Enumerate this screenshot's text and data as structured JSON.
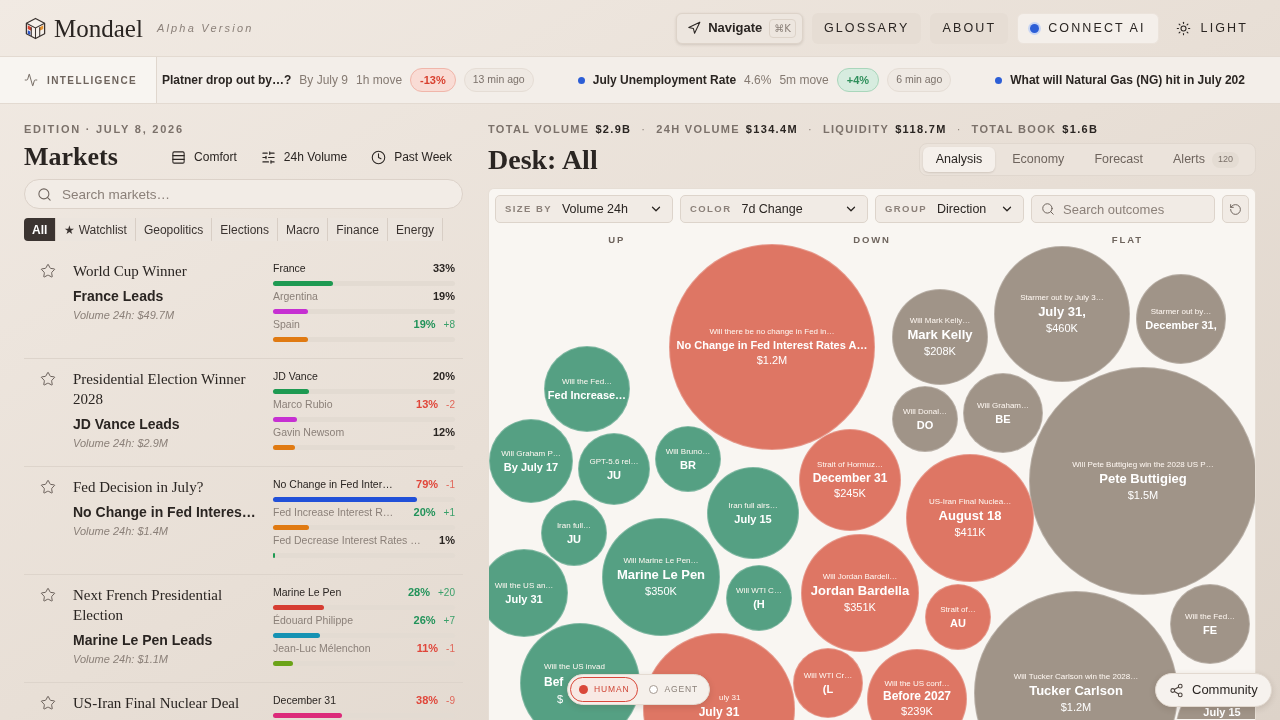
{
  "header": {
    "logo": "Mondael",
    "tagline": "Alpha Version",
    "navigate": {
      "label": "Navigate",
      "shortcut": "⌘K"
    },
    "links": [
      {
        "label": "GLOSSARY",
        "kind": "plain"
      },
      {
        "label": "ABOUT",
        "kind": "plain"
      },
      {
        "label": "CONNECT AI",
        "kind": "connect"
      }
    ],
    "theme_toggle": "LIGHT"
  },
  "ticker": {
    "label": "INTELLIGENCE",
    "items": [
      {
        "bullet": false,
        "title": "Platner drop out by…?",
        "detail": "By July 9",
        "window": "1h move",
        "change": "-13%",
        "kind": "down",
        "age": "13 min ago"
      },
      {
        "bullet": true,
        "title": "July Unemployment Rate",
        "detail": "4.6%",
        "window": "5m move",
        "change": "+4%",
        "kind": "up",
        "age": "6 min ago"
      },
      {
        "bullet": true,
        "title": "What will Natural Gas (NG) hit in July 202"
      }
    ]
  },
  "markets": {
    "edition": "EDITION · JULY 8, 2026",
    "title": "Markets",
    "view_options": [
      "Comfort",
      "24h Volume",
      "Past Week"
    ],
    "search": {
      "placeholder": "Search markets…"
    },
    "filters": [
      {
        "label": "All",
        "selected": true
      },
      {
        "label": "★ Watchlist",
        "selected": false
      },
      {
        "label": "Geopolitics",
        "selected": false
      },
      {
        "label": "Elections",
        "selected": false
      },
      {
        "label": "Macro",
        "selected": false
      },
      {
        "label": "Finance",
        "selected": false
      },
      {
        "label": "Energy",
        "selected": false
      }
    ],
    "rows": [
      {
        "title": "World Cup Winner",
        "leader": "France Leads",
        "volume": "Volume 24h: $49.7M",
        "starred": false,
        "outcomes": [
          {
            "name": "France",
            "pct": "33%",
            "kind": "flat",
            "leading": true,
            "level": 0.33,
            "color": "#1e9a52"
          },
          {
            "name": "Argentina",
            "pct": "19%",
            "kind": "flat",
            "leading": false,
            "level": 0.19,
            "color": "#c630d2"
          },
          {
            "name": "Spain",
            "pct": "19%",
            "change": "+8",
            "kind": "up",
            "leading": false,
            "level": 0.19,
            "color": "#e07a12"
          }
        ]
      },
      {
        "title": "Presidential Election Winner 2028",
        "leader": "JD Vance Leads",
        "volume": "Volume 24h: $2.9M",
        "starred": false,
        "outcomes": [
          {
            "name": "JD Vance",
            "pct": "20%",
            "kind": "flat",
            "leading": true,
            "level": 0.2,
            "color": "#1e9a52"
          },
          {
            "name": "Marco Rubio",
            "pct": "13%",
            "change": "-2",
            "kind": "down",
            "leading": false,
            "level": 0.13,
            "color": "#c630d2"
          },
          {
            "name": "Gavin Newsom",
            "pct": "12%",
            "kind": "flat",
            "leading": false,
            "level": 0.12,
            "color": "#e07a12"
          }
        ]
      },
      {
        "title": "Fed Decision in July?",
        "leader": "No Change in Fed Interes…",
        "volume": "Volume 24h: $1.4M",
        "starred": false,
        "outcomes": [
          {
            "name": "No Change in Fed Inter…",
            "pct": "79%",
            "change": "-1",
            "kind": "down",
            "leading": true,
            "level": 0.79,
            "color": "#2150d8"
          },
          {
            "name": "Fed Increase Interest R…",
            "pct": "20%",
            "change": "+1",
            "kind": "up",
            "leading": false,
            "level": 0.2,
            "color": "#e07a12"
          },
          {
            "name": "Fed Decrease Interest Rates …",
            "pct": "1%",
            "kind": "flat",
            "leading": false,
            "level": 0.01,
            "color": "#1e9a52"
          }
        ]
      },
      {
        "title": "Next French Presidential Election",
        "leader": "Marine Le Pen Leads",
        "volume": "Volume 24h: $1.1M",
        "starred": false,
        "outcomes": [
          {
            "name": "Marine Le Pen",
            "pct": "28%",
            "change": "+20",
            "kind": "up",
            "leading": true,
            "level": 0.28,
            "color": "#d63d32"
          },
          {
            "name": "Édouard Philippe",
            "pct": "26%",
            "change": "+7",
            "kind": "up",
            "leading": false,
            "level": 0.26,
            "color": "#1592b3"
          },
          {
            "name": "Jean-Luc Mélenchon",
            "pct": "11%",
            "change": "-1",
            "kind": "down",
            "leading": false,
            "level": 0.11,
            "color": "#6ba318"
          }
        ]
      },
      {
        "title": "US-Iran Final Nuclear Deal",
        "starred": false,
        "outcomes": [
          {
            "name": "December 31",
            "pct": "38%",
            "change": "-9",
            "kind": "down",
            "leading": true,
            "level": 0.38,
            "color": "#dc2a7a"
          }
        ]
      }
    ]
  },
  "desk": {
    "stats": [
      {
        "label": "TOTAL VOLUME",
        "value": "$2.9B"
      },
      {
        "separator": "·",
        "label": "24H VOLUME",
        "value": "$134.4M"
      },
      {
        "separator": "·",
        "label": "LIQUIDITY",
        "value": "$118.7M"
      },
      {
        "separator": "·",
        "label": "TOTAL BOOK",
        "value": "$1.6B"
      }
    ],
    "title": "Desk: All",
    "tabs": [
      {
        "label": "Analysis",
        "selected": true
      },
      {
        "label": "Economy",
        "selected": false
      },
      {
        "label": "Forecast",
        "selected": false
      },
      {
        "label": "Alerts",
        "selected": false,
        "badge": "120"
      }
    ],
    "controls": [
      {
        "label": "SIZE BY",
        "value": "Volume 24h"
      },
      {
        "label": "COLOR",
        "value": "7d Change"
      },
      {
        "label": "GROUP",
        "value": "Direction"
      }
    ],
    "search": {
      "placeholder": "Search outcomes"
    },
    "groups": [
      "UP",
      "DOWN",
      "FLAT"
    ],
    "bubbles": [
      {
        "kind": "flat",
        "question": "Starmer out by July 3…",
        "label": "July 31,",
        "value": "$460K"
      },
      {
        "kind": "flat",
        "question": "Starmer out by…",
        "label": "December 31,"
      },
      {
        "kind": "down",
        "question": "Will there be no change in Fed in…",
        "label": "No Change in Fed Interest Rates A…",
        "value": "$1.2M"
      },
      {
        "kind": "flat",
        "question": "Will Mark Kelly…",
        "label": "Mark Kelly",
        "value": "$208K"
      },
      {
        "kind": "up",
        "question": "Will the Fed…",
        "label": "Fed Increase…"
      },
      {
        "kind": "flat",
        "question": "Will Graham…",
        "label": "BE"
      },
      {
        "kind": "flat",
        "question": "Will Donal…",
        "label": "DO"
      },
      {
        "kind": "up",
        "question": "Will Graham P…",
        "label": "By July 17"
      },
      {
        "kind": "up",
        "question": "GPT-5.6 rel…",
        "label": "JU"
      },
      {
        "kind": "up",
        "question": "Will Bruno…",
        "label": "BR"
      },
      {
        "kind": "down",
        "question": "Strait of Hormuz…",
        "label": "December 31",
        "value": "$245K"
      },
      {
        "kind": "flat",
        "question": "Will Pete Buttigieg win the 2028 US P…",
        "label": "Pete Buttigieg",
        "value": "$1.5M"
      },
      {
        "kind": "up",
        "question": "Iran full airs…",
        "label": "July 15"
      },
      {
        "kind": "down",
        "question": "US-Iran Final Nuclea…",
        "label": "August 18",
        "value": "$411K"
      },
      {
        "kind": "up",
        "question": "Iran full…",
        "label": "JU"
      },
      {
        "kind": "up",
        "question": "Will Marine Le Pen…",
        "label": "Marine Le Pen",
        "value": "$350K"
      },
      {
        "kind": "up",
        "question": "Will the US an…",
        "label": "July 31"
      },
      {
        "kind": "up",
        "question": "Will WTI C…",
        "label": "(H"
      },
      {
        "kind": "down",
        "question": "Will Jordan Bardell…",
        "label": "Jordan Bardella",
        "value": "$351K"
      },
      {
        "kind": "down",
        "question": "Strait of…",
        "label": "AU"
      },
      {
        "kind": "flat",
        "question": "Will the Fed…",
        "label": "FE"
      },
      {
        "kind": "up",
        "question": "Will the US invad",
        "label": "Bef",
        "value": "$"
      },
      {
        "kind": "down",
        "question": "uly 31",
        "label": "July 31"
      },
      {
        "kind": "down",
        "question": "Will WTI Cr…",
        "label": "(L"
      },
      {
        "kind": "down",
        "question": "Will the US conf…",
        "label": "Before 2027",
        "value": "$239K"
      },
      {
        "kind": "flat",
        "question": "Will Tucker Carlson win the 2028…",
        "label": "Tucker Carlson",
        "value": "$1.2M"
      },
      {
        "kind": "flat",
        "label": "July 15"
      }
    ]
  },
  "mode_toggle": [
    {
      "label": "HUMAN",
      "selected": true
    },
    {
      "label": "AGENT",
      "selected": false
    }
  ],
  "community": {
    "label": "Community"
  }
}
